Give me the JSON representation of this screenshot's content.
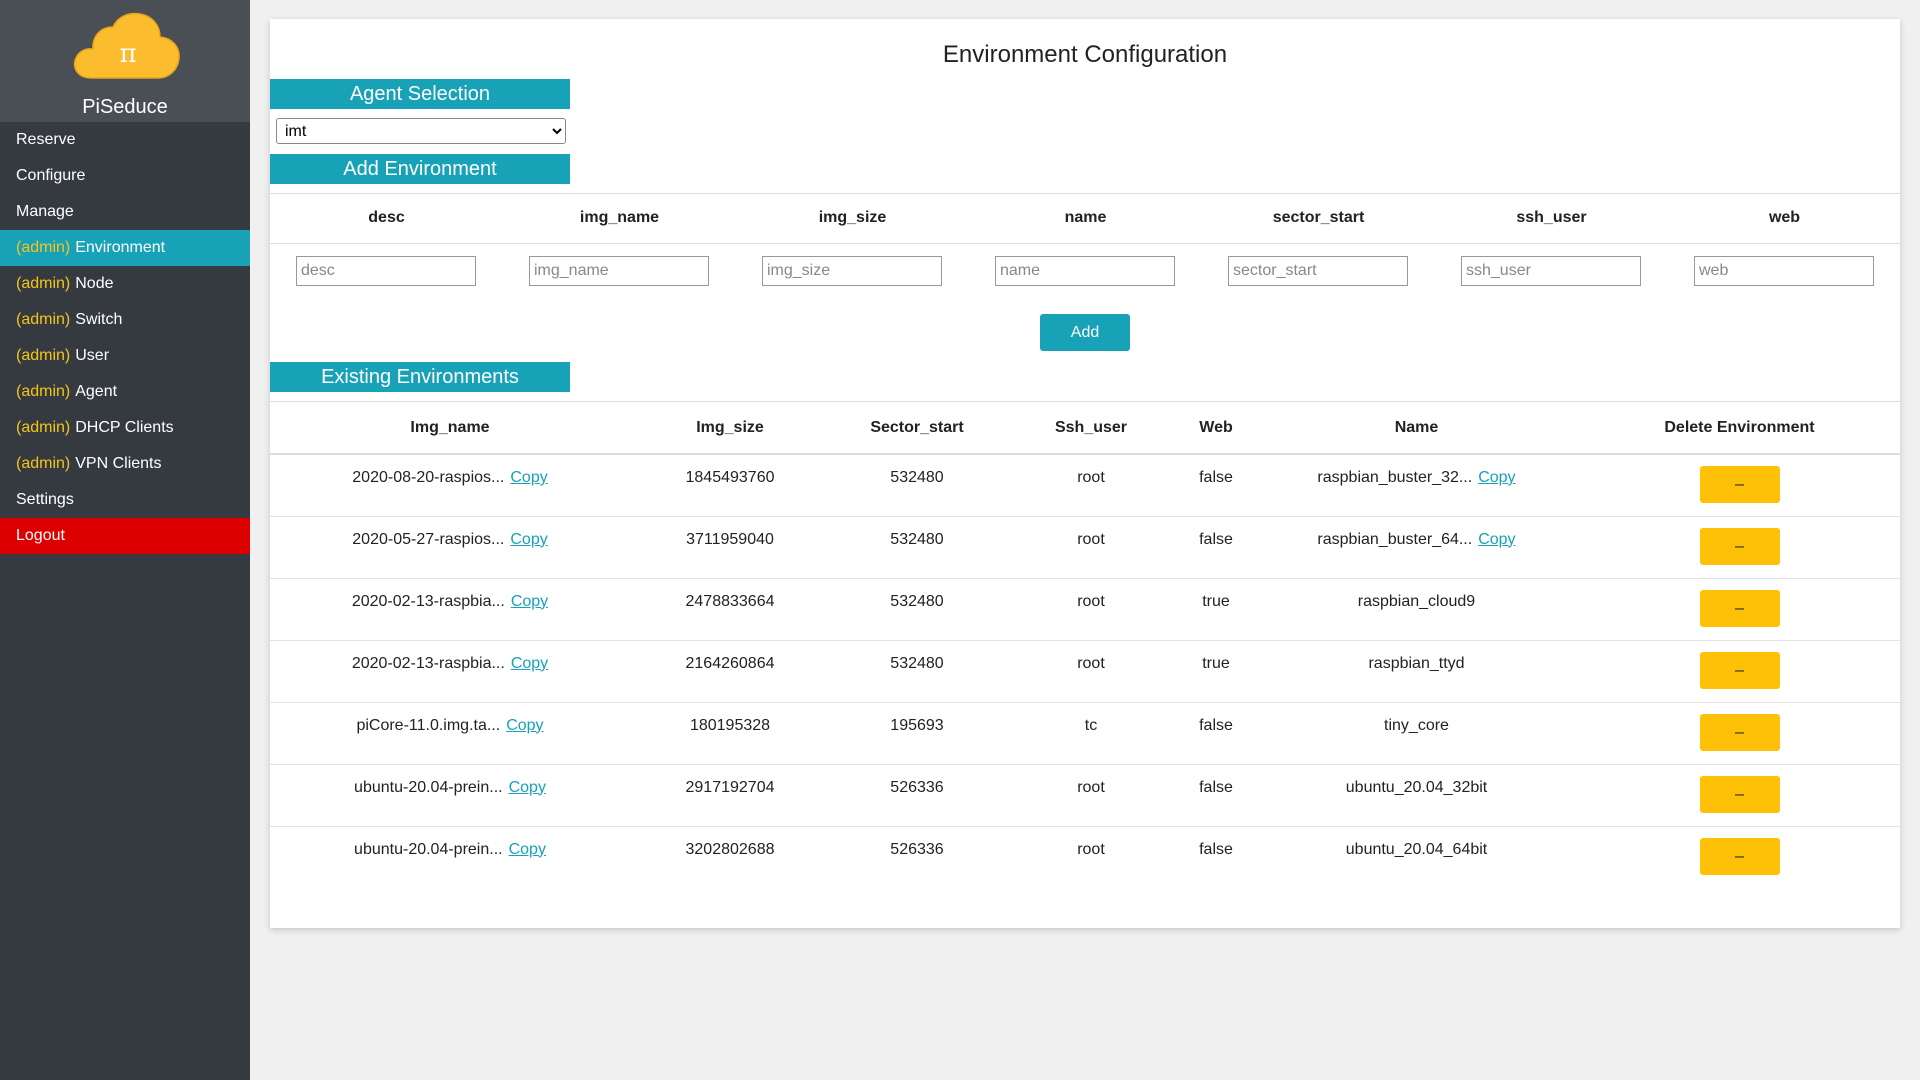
{
  "brand": {
    "name": "PiSeduce",
    "logo_glyph": "π",
    "logo_color": "#fbbc2d"
  },
  "nav": [
    {
      "admin": "",
      "label": "Reserve",
      "state": "normal"
    },
    {
      "admin": "",
      "label": "Configure",
      "state": "normal"
    },
    {
      "admin": "",
      "label": "Manage",
      "state": "normal"
    },
    {
      "admin": "(admin)",
      "label": "Environment",
      "state": "active"
    },
    {
      "admin": "(admin)",
      "label": "Node",
      "state": "normal"
    },
    {
      "admin": "(admin)",
      "label": "Switch",
      "state": "normal"
    },
    {
      "admin": "(admin)",
      "label": "User",
      "state": "normal"
    },
    {
      "admin": "(admin)",
      "label": "Agent",
      "state": "normal"
    },
    {
      "admin": "(admin)",
      "label": "DHCP Clients",
      "state": "normal"
    },
    {
      "admin": "(admin)",
      "label": "VPN Clients",
      "state": "normal"
    },
    {
      "admin": "",
      "label": "Settings",
      "state": "normal"
    },
    {
      "admin": "",
      "label": "Logout",
      "state": "logout"
    }
  ],
  "page": {
    "title": "Environment Configuration"
  },
  "agent_selection": {
    "heading": "Agent Selection",
    "selected": "imt"
  },
  "add_environment": {
    "heading": "Add Environment",
    "columns": [
      "desc",
      "img_name",
      "img_size",
      "name",
      "sector_start",
      "ssh_user",
      "web"
    ],
    "placeholders": [
      "desc",
      "img_name",
      "img_size",
      "name",
      "sector_start",
      "ssh_user",
      "web"
    ],
    "button_label": "Add"
  },
  "existing": {
    "heading": "Existing Environments",
    "headers": [
      "Img_name",
      "Img_size",
      "Sector_start",
      "Ssh_user",
      "Web",
      "Name",
      "Delete Environment"
    ],
    "copy_label": "Copy",
    "delete_label": "–",
    "rows": [
      {
        "img_name": "2020-08-20-raspios...",
        "img_size": "1845493760",
        "sector_start": "532480",
        "ssh_user": "root",
        "web": "false",
        "name": "raspbian_buster_32...",
        "name_copy": true
      },
      {
        "img_name": "2020-05-27-raspios...",
        "img_size": "3711959040",
        "sector_start": "532480",
        "ssh_user": "root",
        "web": "false",
        "name": "raspbian_buster_64...",
        "name_copy": true
      },
      {
        "img_name": "2020-02-13-raspbia...",
        "img_size": "2478833664",
        "sector_start": "532480",
        "ssh_user": "root",
        "web": "true",
        "name": "raspbian_cloud9",
        "name_copy": false
      },
      {
        "img_name": "2020-02-13-raspbia...",
        "img_size": "2164260864",
        "sector_start": "532480",
        "ssh_user": "root",
        "web": "true",
        "name": "raspbian_ttyd",
        "name_copy": false
      },
      {
        "img_name": "piCore-11.0.img.ta...",
        "img_size": "180195328",
        "sector_start": "195693",
        "ssh_user": "tc",
        "web": "false",
        "name": "tiny_core",
        "name_copy": false
      },
      {
        "img_name": "ubuntu-20.04-prein...",
        "img_size": "2917192704",
        "sector_start": "526336",
        "ssh_user": "root",
        "web": "false",
        "name": "ubuntu_20.04_32bit",
        "name_copy": false
      },
      {
        "img_name": "ubuntu-20.04-prein...",
        "img_size": "3202802688",
        "sector_start": "526336",
        "ssh_user": "root",
        "web": "false",
        "name": "ubuntu_20.04_64bit",
        "name_copy": false
      }
    ]
  }
}
